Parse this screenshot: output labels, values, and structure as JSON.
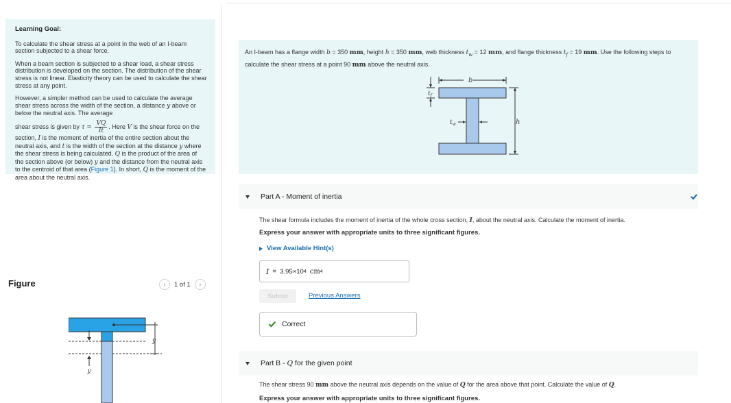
{
  "learning_goal": {
    "title": "Learning Goal:",
    "p1": "To calculate the shear stress at a point in the web of an I-beam section subjected to a shear force.",
    "p2": "When a beam section is subjected to a shear load, a shear stress distribution is developed on the section. The distribution of the shear stress is not linear. Elasticity theory can be used to calculate the shear stress at any point.",
    "p3_a": "However, a simpler method can be used to calculate the average shear stress across the width of the section, a distance",
    "p3_var_y": "y",
    "p3_b": "above or below the neutral axis. The average",
    "p4_a": "shear stress is given by",
    "tau_eq": "τ =",
    "frac_num": "VQ",
    "frac_den": "It",
    "p4_b": ". Here",
    "var_V": "V",
    "p4_c": "is the shear force on the section,",
    "var_I": "I",
    "p4_d": "is the moment of inertia of the entire section about the neutral axis, and",
    "var_t": "t",
    "p4_e": "is the width of the section at the distance",
    "var_y": "y",
    "p4_f": "where the shear stress is being calculated.",
    "var_Q": "Q",
    "p4_g": "is the product of the area of the section above (or below)",
    "var_y2": "y",
    "p4_h": "and the distance from the neutral axis to the centroid of that area (",
    "figure_link": "Figure 1",
    "p4_i": "). In short,",
    "var_Q2": "Q",
    "p4_j": "is the moment of the area about the neutral axis."
  },
  "figure": {
    "title": "Figure",
    "pager": "1 of 1",
    "prev_icon": "chevron-left-icon",
    "next_icon": "chevron-right-icon",
    "label_y_bar": "ȳ",
    "label_y": "y"
  },
  "problem": {
    "t1": "An I-beam has a flange width",
    "var_b": "b",
    "t2": "= 350",
    "u_mm": "mm",
    "t3": ", height",
    "var_h": "h",
    "t4": "= 350",
    "t5": ", web thickness",
    "var_tw": "t",
    "sub_w": "w",
    "t6": "= 12",
    "t7": ", and flange thickness",
    "var_tf": "t",
    "sub_f": "f",
    "t8": "= 19",
    "t9": ". Use the following steps to calculate the shear stress at a point 90",
    "t10": "above the neutral axis.",
    "diagram": {
      "label_b": "b",
      "label_tf": "t",
      "label_tf_sub": "f",
      "label_tw": "t",
      "label_tw_sub": "w",
      "label_h": "h"
    }
  },
  "part_a": {
    "title": "Part A - Moment of inertia",
    "prompt_a": "The shear formula includes the moment of inertia of the whole cross section,",
    "prompt_var": "I",
    "prompt_b": ", about the neutral axis. Calculate the moment of inertia.",
    "instruction": "Express your answer with appropriate units to three significant figures.",
    "hint_label": "View Available Hint(s)",
    "answer_var": "I",
    "answer_eq": "=",
    "answer_value": "3.95×10",
    "answer_exp": "4",
    "answer_unit": "cm",
    "answer_unit_exp": "4",
    "submit_label": "Submit",
    "prev_answers_label": "Previous Answers",
    "result_label": "Correct",
    "status_icon": "checkmark-icon"
  },
  "part_b": {
    "title": "Part B -",
    "title_var": "Q",
    "title_rest": "for the given point",
    "prompt_a": "The shear stress 90",
    "prompt_unit": "mm",
    "prompt_b": "above the neutral axis depends on the value of",
    "prompt_var": "Q",
    "prompt_c": "for the area above that point. Calculate the value of",
    "prompt_var2": "Q",
    "prompt_d": ".",
    "instruction": "Express your answer with appropriate units to three significant figures."
  },
  "colors": {
    "panel_bg": "#e8f6f7",
    "link": "#1a6fb5",
    "beam_light": "#a9c9ec",
    "beam_dark": "#29a3e6",
    "correct_green": "#3a8f2a"
  }
}
